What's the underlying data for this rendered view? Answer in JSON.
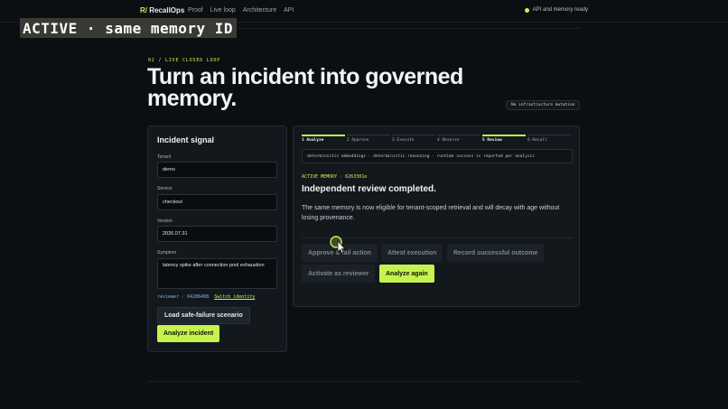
{
  "overlay": {
    "text": "ACTIVE · same memory ID"
  },
  "nav": {
    "brand_mark": "R/",
    "brand_name": "RecallOps",
    "links": [
      "Proof",
      "Live loop",
      "Architecture",
      "API"
    ],
    "status": "API and memory ready",
    "status_color": "#c6f24e"
  },
  "hero": {
    "eyebrow": "02 / LIVE CLOSED LOOP",
    "title": "Turn an incident into governed memory.",
    "badge": "No infrastructure mutation"
  },
  "incident": {
    "title": "Incident signal",
    "tenant_label": "Tenant",
    "tenant_value": "demo",
    "service_label": "Service",
    "service_value": "checkout",
    "version_label": "Version",
    "version_value": "2026.07.31",
    "symptom_label": "Symptom",
    "symptom_value": "latency spike after connection pool exhaustion",
    "identity_role": "reviewer · 64286408",
    "switch_identity": "Switch identity",
    "load_button": "Load safe-failure scenario",
    "analyze_button": "Analyze incident"
  },
  "workflow": {
    "steps": [
      "1 Analyze",
      "2 Approve",
      "3 Execute",
      "4 Observe",
      "5 Review",
      "6 Recall"
    ],
    "current_step": 5,
    "mode": "deterministic embeddings · deterministic reasoning · runtime success is reported per analysis",
    "active_memory": "ACTIVE MEMORY · 6263301e",
    "review_title": "Independent review completed.",
    "review_body": "The same memory is now eligible for tenant-scoped retrieval and will decay with age without losing provenance.",
    "actions": {
      "approve": "Approve & fail action",
      "attest": "Attest execution",
      "record": "Record successful outcome",
      "activate": "Activate as reviewer",
      "analyze_again": "Analyze again"
    }
  },
  "colors": {
    "accent": "#c6f24e",
    "background": "#0c0f12",
    "panel": "#13181d"
  },
  "icons": {
    "cursor": "mouse-pointer-icon"
  }
}
